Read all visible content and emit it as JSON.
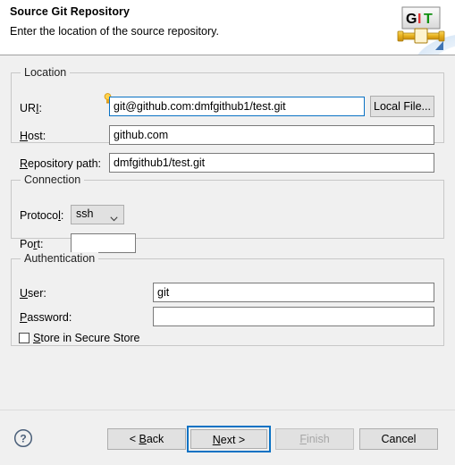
{
  "header": {
    "title": "Source Git Repository",
    "description": "Enter the location of the source repository.",
    "logo": {
      "name": "git-logo",
      "letters": [
        {
          "char": "G",
          "color": "#000000"
        },
        {
          "char": "I",
          "color": "#e03030"
        },
        {
          "char": "T",
          "color": "#109010"
        }
      ]
    }
  },
  "location": {
    "group_title": "Location",
    "uri": {
      "label_pre": "UR",
      "label_mnemonic": "I",
      "label_post": ":",
      "value": "git@github.com:dmfgithub1/test.git",
      "placeholder": "",
      "focused": true,
      "hint_icon": "lightbulb-icon"
    },
    "host": {
      "label_pre": "",
      "label_mnemonic": "H",
      "label_post": "ost:",
      "value": "github.com",
      "placeholder": ""
    },
    "repository_path": {
      "label_pre": "",
      "label_mnemonic": "R",
      "label_post": "epository path:",
      "value": "dmfgithub1/test.git",
      "placeholder": ""
    },
    "local_file_button": "Local File..."
  },
  "connection": {
    "group_title": "Connection",
    "protocol": {
      "label_pre": "Protoco",
      "label_mnemonic": "l",
      "label_post": ":",
      "selected": "ssh",
      "options": [
        "ssh"
      ]
    },
    "port": {
      "label_pre": "Po",
      "label_mnemonic": "r",
      "label_post": "t:",
      "value": "",
      "placeholder": ""
    }
  },
  "authentication": {
    "group_title": "Authentication",
    "user": {
      "label_pre": "",
      "label_mnemonic": "U",
      "label_post": "ser:",
      "value": "git",
      "placeholder": ""
    },
    "password": {
      "label_pre": "",
      "label_mnemonic": "P",
      "label_post": "assword:",
      "value": "",
      "placeholder": ""
    },
    "store_secure": {
      "label_pre": "",
      "label_mnemonic": "S",
      "label_post": "tore in Secure Store",
      "checked": false
    }
  },
  "footer": {
    "help_icon": "help-icon",
    "back": {
      "pre": "< ",
      "mnemonic": "B",
      "post": "ack"
    },
    "next": {
      "pre": "",
      "mnemonic": "N",
      "post": "ext >",
      "focused": true
    },
    "finish": {
      "pre": "",
      "mnemonic": "F",
      "post": "inish",
      "disabled": true
    },
    "cancel": {
      "pre": "Cancel",
      "mnemonic": "",
      "post": ""
    }
  },
  "colors": {
    "page_bg": "#f0f0f0",
    "header_bg": "#ffffff",
    "focus_blue": "#0a72c4",
    "button_bg": "#e1e1e1",
    "border_grey": "#c8c8c8",
    "field_border": "#7a7a7a",
    "disabled_text": "#a6a6a6"
  }
}
